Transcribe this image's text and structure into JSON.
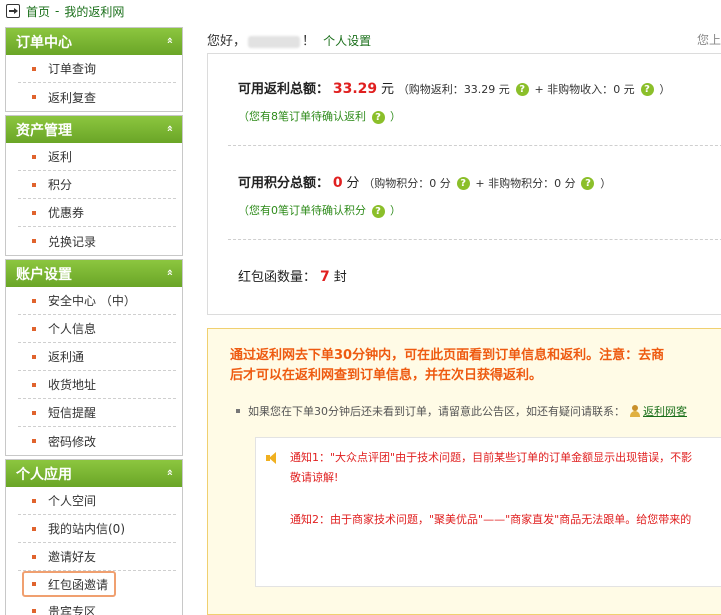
{
  "breadcrumb": {
    "home": "首页",
    "separator": "-",
    "current": "我的返利网"
  },
  "sidebar": {
    "sections": [
      {
        "title": "订单中心",
        "items": [
          "订单查询",
          "返利复查"
        ]
      },
      {
        "title": "资产管理",
        "items": [
          "返利",
          "积分",
          "优惠券",
          "兑换记录"
        ]
      },
      {
        "title": "账户设置",
        "items": [
          "安全中心 （中）",
          "个人信息",
          "返利通",
          "收货地址",
          "短信提醒",
          "密码修改"
        ]
      },
      {
        "title": "个人应用",
        "items": [
          "个人空间",
          "我的站内信(0)",
          "邀请好友",
          "红包函邀请",
          "贵宾专区"
        ]
      }
    ],
    "collapse_glyph": "»",
    "active_item": "红包函邀请"
  },
  "greeting": {
    "prefix": "您好，",
    "suffix": "！",
    "settings_link": "个人设置",
    "right_text": "您上"
  },
  "rebate": {
    "label": "可用返利总额：",
    "amount": "33.29",
    "unit": "元",
    "breakdown_open": "（购物返利：",
    "shopping_value": "33.29 元",
    "plus_text": "+ 非购物收入：",
    "nonshopping_value": "0 元",
    "breakdown_close": "）",
    "pending_note": "（您有8笔订单待确认返利",
    "pending_close": "）"
  },
  "points": {
    "label": "可用积分总额：",
    "amount": "0",
    "unit": "分",
    "breakdown_open": "（购物积分：",
    "shopping_value": "0 分",
    "plus_text": "+ 非购物积分：",
    "nonshopping_value": "0 分",
    "breakdown_close": "）",
    "pending_note": "（您有0笔订单待确认积分",
    "pending_close": "）"
  },
  "envelope": {
    "label": "红包函数量：",
    "count": "7",
    "unit": "封"
  },
  "notice": {
    "headline_line1": "通过返利网去下单30分钟内，可在此页面看到订单信息和返利。注意：去商",
    "headline_line2": "后才可以在返利网查到订单信息，并在次日获得返利。",
    "bullet_text": "如果您在下单30分钟后还未看到订单，请留意此公告区，如还有疑问请联系：",
    "contact_link": "返利网客",
    "notice1_line1": "通知1：\"大众点评团\"由于技术问题，目前某些订单的订单金额显示出现错误，不影",
    "notice1_line2": "敬请谅解!",
    "notice2_line1": "通知2：由于商家技术问题，\"聚美优品\"——\"商家直发\"商品无法跟单。给您带来的"
  },
  "icons": {
    "question": "?"
  },
  "colors": {
    "accent_green": "#7ab632",
    "red": "#e02020",
    "orange": "#ee5a10",
    "link_green": "#1a6f1a"
  }
}
